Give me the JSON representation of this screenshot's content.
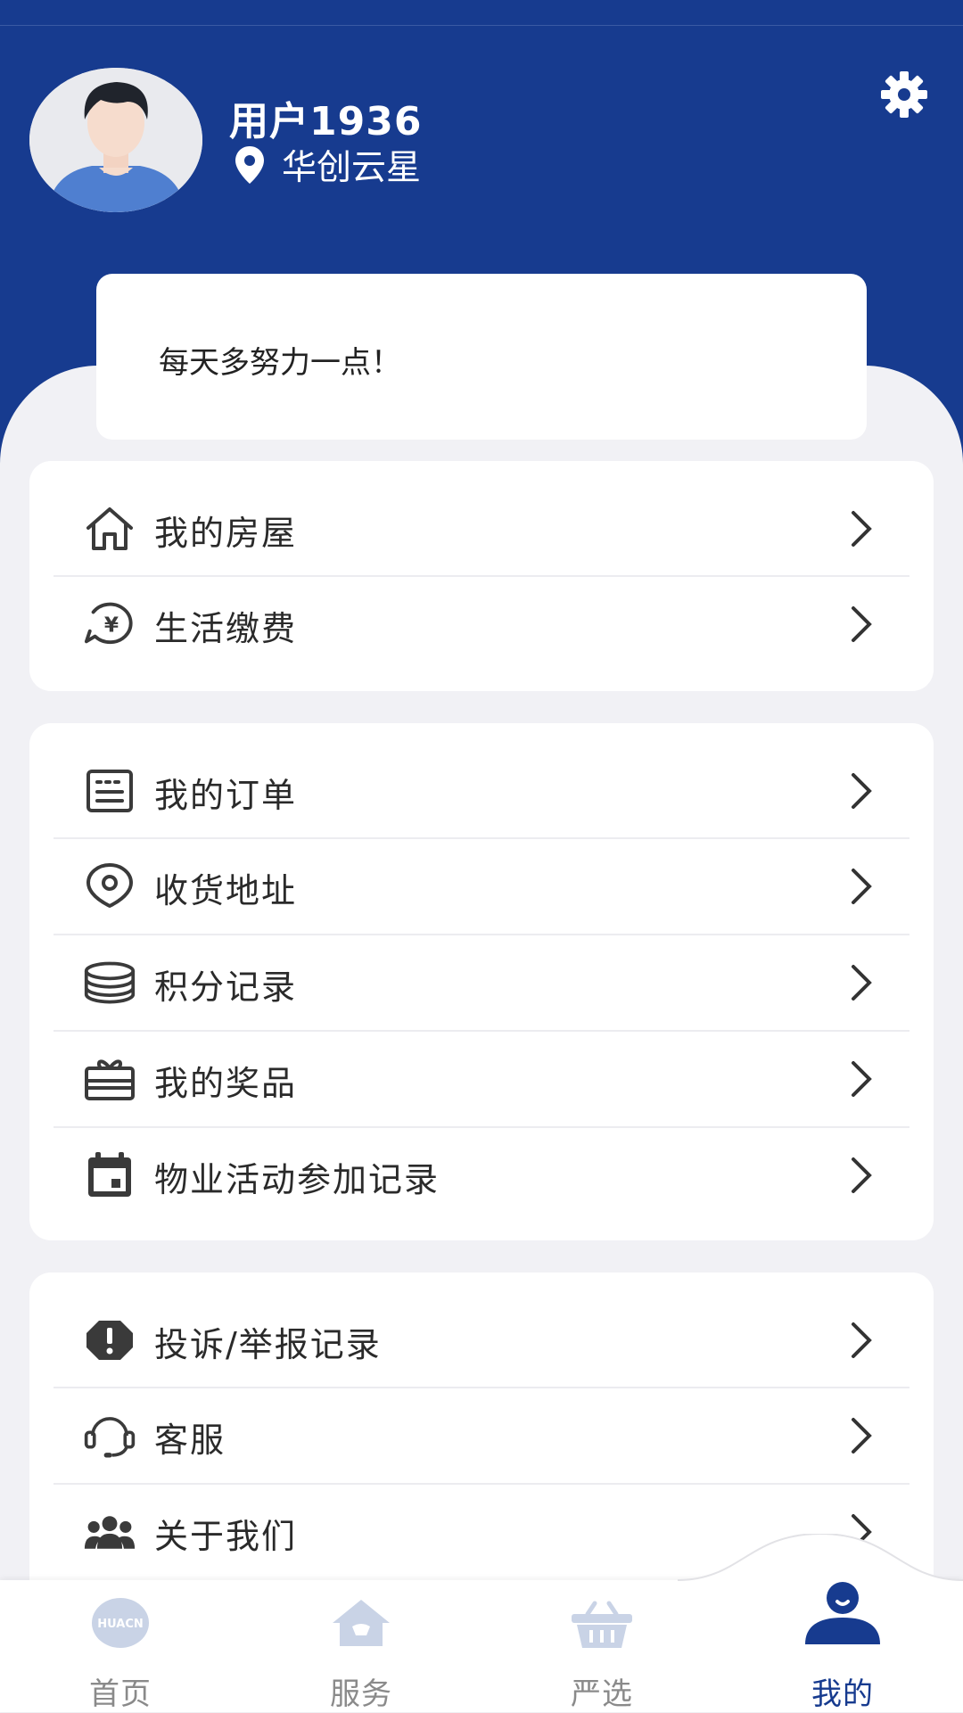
{
  "profile": {
    "username": "用户1936",
    "location": "华创云星"
  },
  "motto": "每天多努力一点！",
  "menu_groups": [
    [
      {
        "label": "我的房屋",
        "icon": "house-icon"
      },
      {
        "label": "生活缴费",
        "icon": "yuan-bill-icon"
      }
    ],
    [
      {
        "label": "我的订单",
        "icon": "order-icon"
      },
      {
        "label": "收货地址",
        "icon": "address-pin-icon"
      },
      {
        "label": "积分记录",
        "icon": "coin-stack-icon"
      },
      {
        "label": "我的奖品",
        "icon": "gift-box-icon"
      },
      {
        "label": "物业活动参加记录",
        "icon": "calendar-icon"
      }
    ],
    [
      {
        "label": "投诉/举报记录",
        "icon": "alert-octagon-icon"
      },
      {
        "label": "客服",
        "icon": "headset-icon"
      },
      {
        "label": "关于我们",
        "icon": "group-icon"
      }
    ]
  ],
  "tabs": [
    {
      "label": "首页",
      "icon": "huacn-logo-icon",
      "active": false
    },
    {
      "label": "服务",
      "icon": "service-house-icon",
      "active": false
    },
    {
      "label": "严选",
      "icon": "basket-icon",
      "active": false
    },
    {
      "label": "我的",
      "icon": "user-profile-icon",
      "active": true
    }
  ],
  "logo_text": "HUACN",
  "colors": {
    "primary": "#173b8f",
    "background": "#f1f1f5",
    "inactive_tab": "#8a8a8a"
  }
}
